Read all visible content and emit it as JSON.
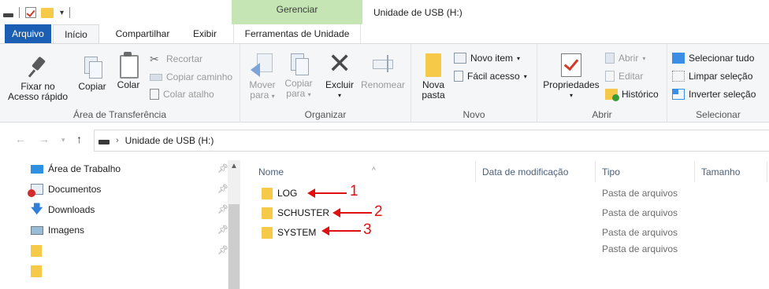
{
  "titlebar": {
    "contextual_tab": "Gerenciar",
    "window_title": "Unidade de USB (H:)"
  },
  "tabs": {
    "file": "Arquivo",
    "home": "Início",
    "share": "Compartilhar",
    "view": "Exibir",
    "drive_tools": "Ferramentas de Unidade"
  },
  "ribbon": {
    "clipboard": {
      "label": "Área de Transferência",
      "pin_line1": "Fixar no",
      "pin_line2": "Acesso rápido",
      "copy": "Copiar",
      "paste": "Colar",
      "cut": "Recortar",
      "copy_path": "Copiar caminho",
      "paste_shortcut": "Colar atalho"
    },
    "organize": {
      "label": "Organizar",
      "move_line1": "Mover",
      "move_line2": "para",
      "copy_line1": "Copiar",
      "copy_line2": "para",
      "delete": "Excluir",
      "rename": "Renomear"
    },
    "new": {
      "label": "Novo",
      "new_folder_line1": "Nova",
      "new_folder_line2": "pasta",
      "new_item": "Novo item",
      "easy_access": "Fácil acesso"
    },
    "open": {
      "label": "Abrir",
      "properties": "Propriedades",
      "open": "Abrir",
      "edit": "Editar",
      "history": "Histórico"
    },
    "select": {
      "label": "Selecionar",
      "select_all": "Selecionar tudo",
      "select_none": "Limpar seleção",
      "invert": "Inverter seleção"
    }
  },
  "address": {
    "path": "Unidade de USB (H:)"
  },
  "nav": {
    "items": [
      {
        "label": "Área de Trabalho"
      },
      {
        "label": "Documentos"
      },
      {
        "label": "Downloads"
      },
      {
        "label": "Imagens"
      },
      {
        "label": ""
      },
      {
        "label": ""
      }
    ]
  },
  "filelist": {
    "columns": {
      "name": "Nome",
      "modified": "Data de modificação",
      "type": "Tipo",
      "size": "Tamanho"
    },
    "rows": [
      {
        "name": "LOG",
        "type": "Pasta de arquivos",
        "annotation": "1"
      },
      {
        "name": "SCHUSTER",
        "type": "Pasta de arquivos",
        "annotation": "2"
      },
      {
        "name": "SYSTEM",
        "type": "Pasta de arquivos",
        "annotation": "3"
      },
      {
        "name": "",
        "type": "Pasta de arquivos",
        "annotation": ""
      }
    ]
  },
  "colors": {
    "file_tab": "#1a5fb4",
    "contextual_tab": "#c5e5b4",
    "folder": "#f7c948",
    "annotation": "#e01010"
  }
}
